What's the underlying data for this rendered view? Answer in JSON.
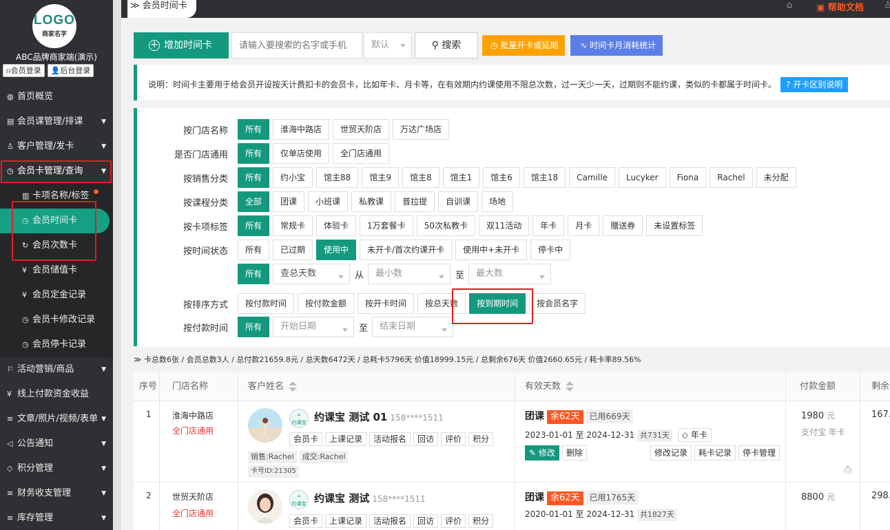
{
  "sidebar": {
    "logo_line1": "LOGO",
    "logo_line2": "商家名字",
    "brand": "ABC品牌商家端(演示)",
    "member_login": "会员登录",
    "admin_login": "后台登录",
    "menu": [
      {
        "label": "首页概览",
        "icon": "globe-icon"
      },
      {
        "label": "会员课管理/排课",
        "icon": "document-icon"
      },
      {
        "label": "客户管理/发卡",
        "icon": "user-icon"
      },
      {
        "label": "会员卡管理/查询",
        "icon": "clock-icon"
      },
      {
        "label": "卡项名称/标签",
        "icon": "book-icon"
      },
      {
        "label": "会员时间卡",
        "icon": "clock-icon"
      },
      {
        "label": "会员次数卡",
        "icon": "refresh-icon"
      },
      {
        "label": "会员储值卡",
        "icon": "yen-icon"
      },
      {
        "label": "会员定金记录",
        "icon": "yen-icon"
      },
      {
        "label": "会员卡修改记录",
        "icon": "clock-icon"
      },
      {
        "label": "会员停卡记录",
        "icon": "clock-icon"
      },
      {
        "label": "活动营销/商品",
        "icon": "flag-icon"
      },
      {
        "label": "线上付款资金收益",
        "icon": "yen-icon"
      },
      {
        "label": "文章/照片/视频/表单",
        "icon": "sliders-icon"
      },
      {
        "label": "公告通知",
        "icon": "megaphone-icon"
      },
      {
        "label": "积分管理",
        "icon": "diamond-icon"
      },
      {
        "label": "财务收支管理",
        "icon": "sliders-icon"
      },
      {
        "label": "库存管理",
        "icon": "sliders-icon"
      }
    ]
  },
  "topbar": {
    "tab_label": "会员时间卡",
    "help": "帮助文档"
  },
  "toolbar": {
    "add_label": "增加时间卡",
    "search_placeholder": "请输入要搜索的名字或手机",
    "select_value": "默认",
    "search_label": "搜索",
    "batch_label": "批量开卡或延期",
    "stats_label": "时间卡月消耗统计"
  },
  "note": {
    "text": "说明：时间卡主要用于给会员开设按天计费扣卡的会员卡，比如年卡、月卡等，在有效期内约课使用不限总次数，过一天少一天，过期则不能约课，类似的卡都属于时间卡。",
    "help_btn": "开卡区别说明"
  },
  "filters": {
    "store": {
      "label": "按门店名称",
      "options": [
        "所有",
        "淮海中路店",
        "世贸天阶店",
        "万达广场店"
      ]
    },
    "general": {
      "label": "是否门店通用",
      "options": [
        "所有",
        "仅单店使用",
        "全门店通用"
      ]
    },
    "sales": {
      "label": "按销售分类",
      "options": [
        "所有",
        "约小宝",
        "馆主88",
        "馆主9",
        "馆主8",
        "馆主1",
        "馆主6",
        "馆主18",
        "Camille",
        "Lucyker",
        "Fiona",
        "Rachel",
        "未分配"
      ]
    },
    "course": {
      "label": "按课程分类",
      "options": [
        "全部",
        "团课",
        "小班课",
        "私教课",
        "普拉提",
        "自训课",
        "场地"
      ]
    },
    "tag": {
      "label": "按卡项标签",
      "options": [
        "所有",
        "常规卡",
        "体验卡",
        "1万套餐卡",
        "50次私教卡",
        "双11活动",
        "年卡",
        "月卡",
        "赠送券",
        "未设置标签"
      ]
    },
    "time_status": {
      "label": "按时间状态",
      "options": [
        "所有",
        "已过期",
        "使用中",
        "未开卡/首次约课开卡",
        "使用中+未开卡",
        "停卡中"
      ]
    },
    "days": {
      "all": "所有",
      "type": "查总天数",
      "from": "从",
      "min": "最小数",
      "to": "至",
      "max": "最大数"
    },
    "sort": {
      "label": "按排序方式",
      "options": [
        "按付款时间",
        "按付款金额",
        "按开卡时间",
        "按总天数",
        "按到期时间",
        "按会员名字"
      ]
    },
    "pay": {
      "label": "按付款时间",
      "all": "所有",
      "start": "开始日期",
      "to": "至",
      "end": "结束日期"
    }
  },
  "summary": "卡总数6张 / 会员总数3人 / 总付款21659.8元 / 总天数6472天 / 总耗卡5796天 价值18999.15元 / 总剩余676天 价值2660.65元 / 耗卡率89.56%",
  "table": {
    "headers": {
      "no": "序号",
      "store": "门店名称",
      "customer": "客户姓名",
      "valid": "有效天数",
      "amount": "付款金额",
      "remain": "剩余"
    },
    "rows": [
      {
        "no": "1",
        "store": "淮海中路店",
        "store_scope": "全门店通用",
        "name": "约课宝 测试 01",
        "phone": "158****1511",
        "actions": [
          "会员卡",
          "上课记录",
          "活动报名",
          "回访",
          "评价",
          "积分"
        ],
        "sales": "销售:Rachel",
        "deal": "成交:Rachel",
        "card_id": "卡号ID:21305",
        "type": "团课",
        "remain_days": "余62天",
        "used": "已用669天",
        "dates": "2023-01-01 至 2024-12-31",
        "total": "共731天",
        "tag": "年卡",
        "edit": "修改",
        "delete": "删除",
        "links": [
          "修改记录",
          "耗卡记录",
          "停卡管理"
        ],
        "amount": "1980",
        "unit": "元",
        "pay_method": "支付宝 年卡",
        "remain_value": "167."
      },
      {
        "no": "2",
        "store": "世贸天阶店",
        "store_scope": "全门店通用",
        "name": "约课宝 测试",
        "phone": "158****1511",
        "actions": [
          "会员卡",
          "上课记录",
          "活动报名",
          "回访",
          "评价",
          "积分"
        ],
        "type": "团课",
        "remain_days": "余62天",
        "used": "已用1765天",
        "dates": "2020-01-01 至 2024-12-31",
        "total": "共1827天",
        "amount": "8800",
        "unit": "元",
        "remain_value": "298."
      }
    ]
  },
  "yk_logo_text": "约课宝"
}
